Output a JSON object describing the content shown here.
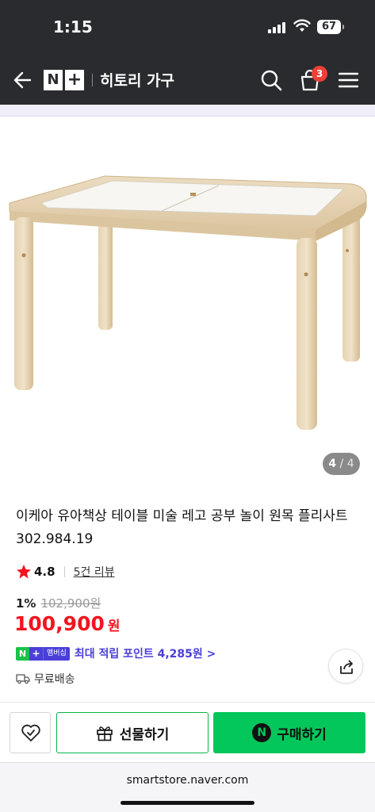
{
  "status_bar": {
    "time": "1:15",
    "battery": "67"
  },
  "header": {
    "brand_n": "N",
    "brand_plus": "+",
    "store_name": "히토리 가구",
    "cart_count": "3"
  },
  "gallery": {
    "current": "4",
    "separator": "/",
    "total": "4"
  },
  "product": {
    "title": "이케아 유아책상 테이블 미술 레고 공부 놀이 원목 플리사트 302.984.19",
    "rating": "4.8",
    "reviews": "5건 리뷰",
    "discount": "1%",
    "original_price": "102,900원",
    "price": "100,900",
    "currency": "원",
    "membership_label": "멤버십",
    "points_text": "최대 적립 포인트 4,285원 >",
    "shipping": "무료배송"
  },
  "actions": {
    "gift_label": "선물하기",
    "buy_label": "구매하기",
    "buy_icon_letter": "N"
  },
  "browser": {
    "url": "smartstore.naver.com"
  },
  "colors": {
    "header_bg": "#2a2b2f",
    "price_red": "#f3141e",
    "naver_green": "#03c75a",
    "membership_purple": "#4a3fd9",
    "badge_red": "#f04035"
  },
  "icons": [
    "back-arrow-icon",
    "search-icon",
    "shopping-bag-icon",
    "menu-icon",
    "star-icon",
    "share-icon",
    "truck-icon",
    "heart-check-icon",
    "gift-icon"
  ]
}
